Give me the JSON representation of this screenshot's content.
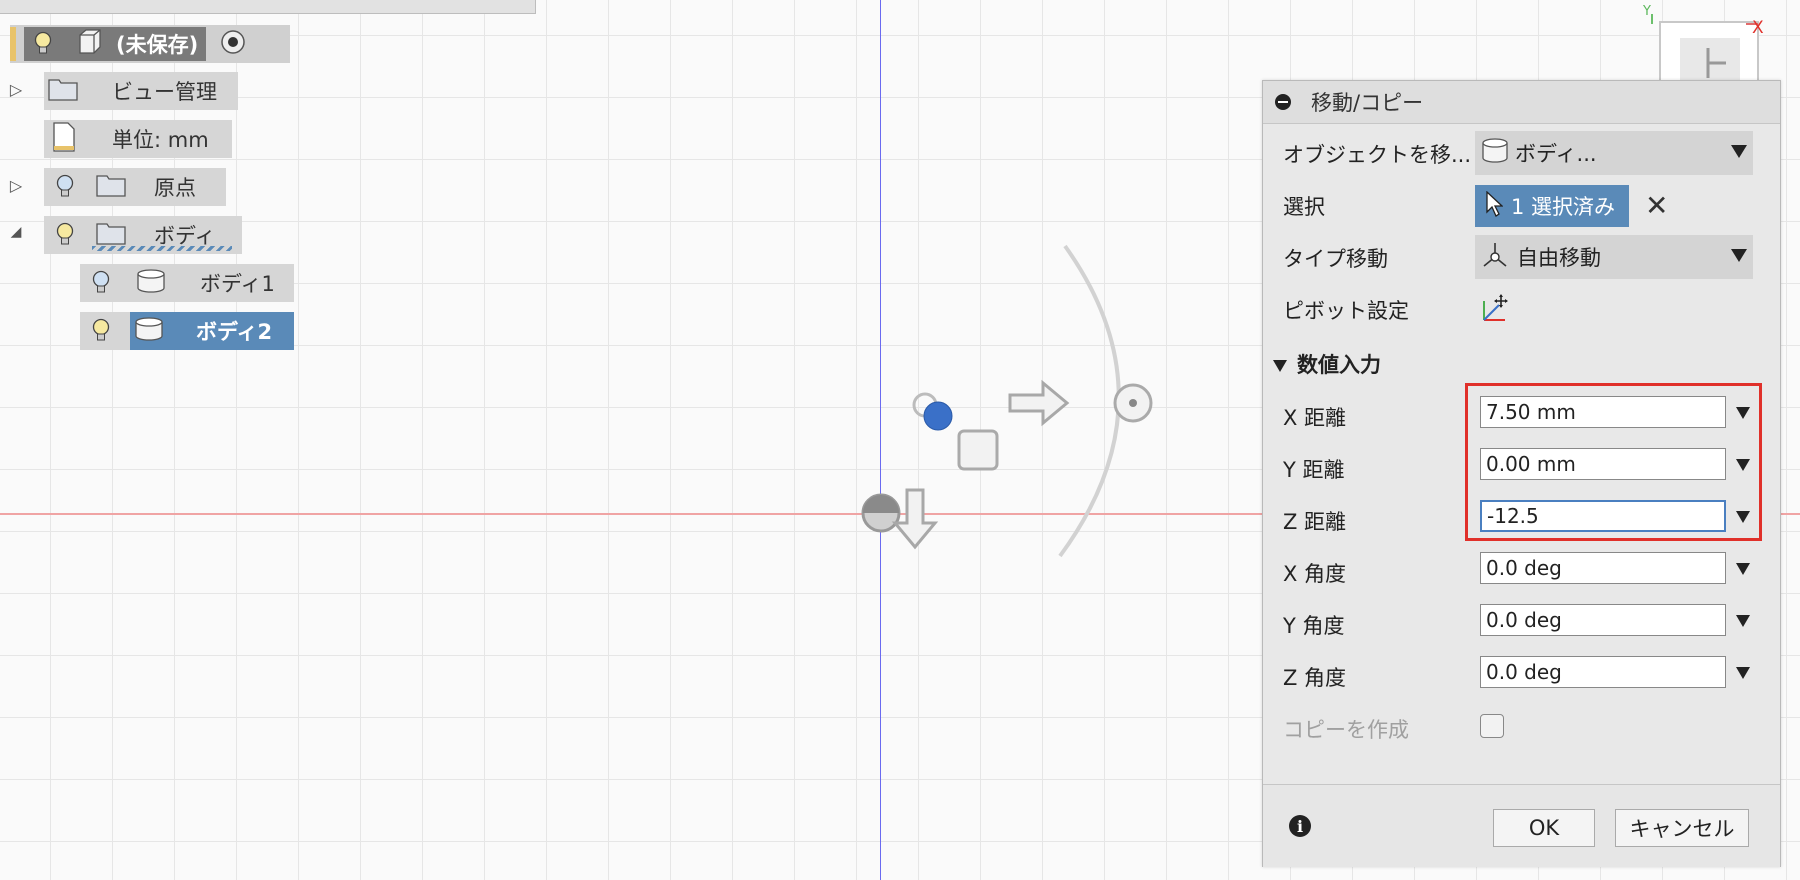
{
  "browser": {
    "root_label": "(未保存)",
    "items": [
      {
        "label": "ビュー管理"
      },
      {
        "label": "単位: mm"
      },
      {
        "label": "原点"
      },
      {
        "label": "ボディ"
      },
      {
        "label": "ボディ1"
      },
      {
        "label": "ボディ2"
      }
    ]
  },
  "viewcube": {
    "x_axis": "X",
    "y_axis": "Y"
  },
  "dialog": {
    "title": "移動/コピー",
    "object_label": "オブジェクトを移...",
    "object_value": "ボディ...",
    "select_label": "選択",
    "select_value": "1 選択済み",
    "type_label": "タイプ移動",
    "type_value": "自由移動",
    "pivot_label": "ピボット設定",
    "section_label": "数値入力",
    "fields": [
      {
        "label": "X 距離",
        "value": "7.50 mm"
      },
      {
        "label": "Y 距離",
        "value": "0.00 mm"
      },
      {
        "label": "Z 距離",
        "value": "-12.5"
      },
      {
        "label": "X 角度",
        "value": "0.0 deg"
      },
      {
        "label": "Y 角度",
        "value": "0.0 deg"
      },
      {
        "label": "Z 角度",
        "value": "0.0 deg"
      }
    ],
    "copy_label": "コピーを作成",
    "copy_checked": false,
    "ok_label": "OK",
    "cancel_label": "キャンセル"
  },
  "colors": {
    "accent": "#5a8ab8",
    "highlight_box": "#e0302a",
    "axis_x": "#f0a4a4",
    "axis_y": "#6a6af0"
  }
}
